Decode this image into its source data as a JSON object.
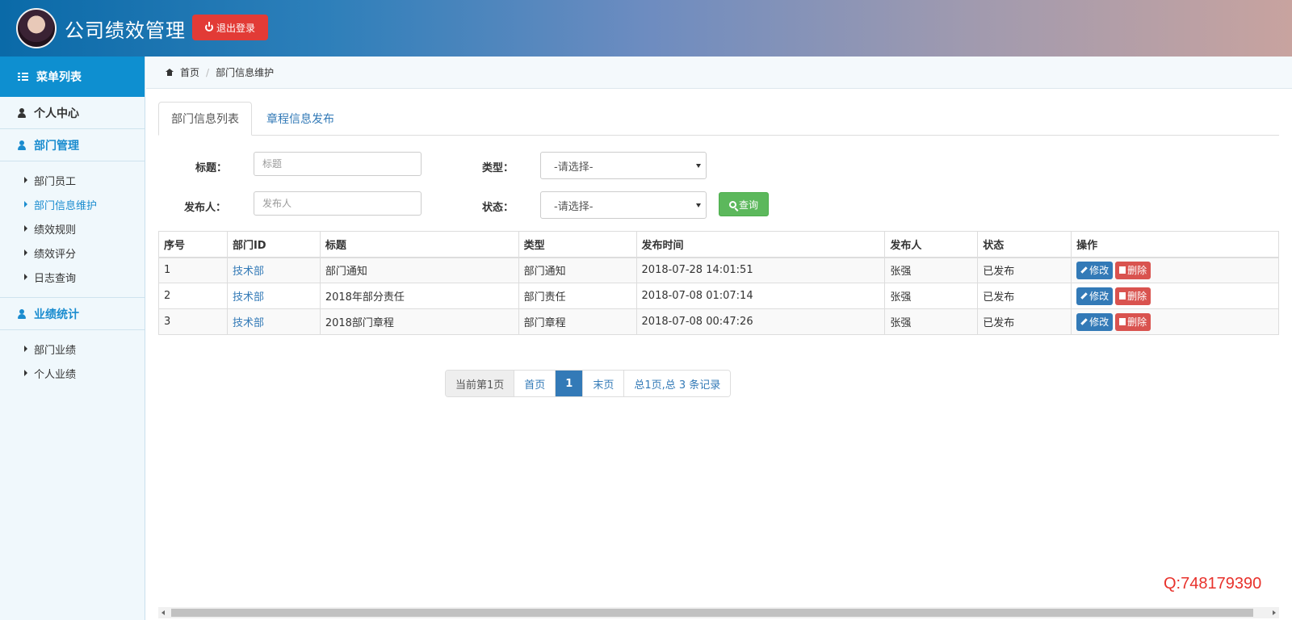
{
  "header": {
    "title": "公司绩效管理",
    "logout_label": "退出登录"
  },
  "sidebar": {
    "menu_title": "菜单列表",
    "personal": "个人中心",
    "dept_section": "部门管理",
    "dept_items": [
      "部门员工",
      "部门信息维护",
      "绩效规则",
      "绩效评分",
      "日志查询"
    ],
    "perf_section": "业绩统计",
    "perf_items": [
      "部门业绩",
      "个人业绩"
    ]
  },
  "breadcrumb": {
    "home": "首页",
    "current": "部门信息维护"
  },
  "tabs": [
    "部门信息列表",
    "章程信息发布"
  ],
  "search": {
    "title_label": "标题：",
    "title_placeholder": "标题",
    "type_label": "类型：",
    "type_value": "-请选择-",
    "publisher_label": "发布人：",
    "publisher_placeholder": "发布人",
    "status_label": "状态：",
    "status_value": "-请选择-",
    "query_label": "查询"
  },
  "table": {
    "headers": [
      "序号",
      "部门ID",
      "标题",
      "类型",
      "发布时间",
      "发布人",
      "状态",
      "操作"
    ],
    "rows": [
      [
        "1",
        "技术部",
        "部门通知",
        "部门通知",
        "2018-07-28 14:01:51",
        "张强",
        "已发布"
      ],
      [
        "2",
        "技术部",
        "2018年部分责任",
        "部门责任",
        "2018-07-08 01:07:14",
        "张强",
        "已发布"
      ],
      [
        "3",
        "技术部",
        "2018部门章程",
        "部门章程",
        "2018-07-08 00:47:26",
        "张强",
        "已发布"
      ]
    ],
    "edit_label": "修改",
    "delete_label": "删除"
  },
  "pagination": {
    "current_info": "当前第1页",
    "first": "首页",
    "page": "1",
    "last": "末页",
    "summary": "总1页,总 3 条记录"
  },
  "watermark": "Q:748179390"
}
